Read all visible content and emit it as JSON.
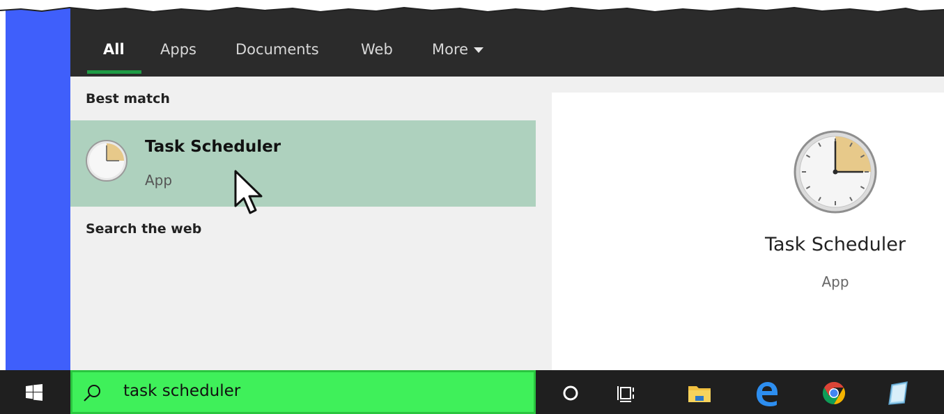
{
  "filter_tabs": [
    "All",
    "Apps",
    "Documents",
    "Web",
    "More"
  ],
  "results": {
    "best_match_label": "Best match",
    "best_match": {
      "title": "Task Scheduler",
      "subtitle": "App"
    },
    "search_web_label": "Search the web"
  },
  "preview": {
    "title": "Task Scheduler",
    "subtitle": "App"
  },
  "taskbar": {
    "search_value": "task scheduler",
    "icons": [
      "windows-start-icon",
      "cortana-icon",
      "task-view-icon",
      "file-explorer-icon",
      "edge-icon",
      "chrome-icon",
      "notepad-icon"
    ]
  },
  "colors": {
    "accent_sidebar": "#3f5ffb",
    "filter_bar": "#2b2b2b",
    "tab_underline": "#1e9b45",
    "selected_result": "#aed1be",
    "search_box": "#3ff05a",
    "taskbar": "#1f1f1f"
  }
}
